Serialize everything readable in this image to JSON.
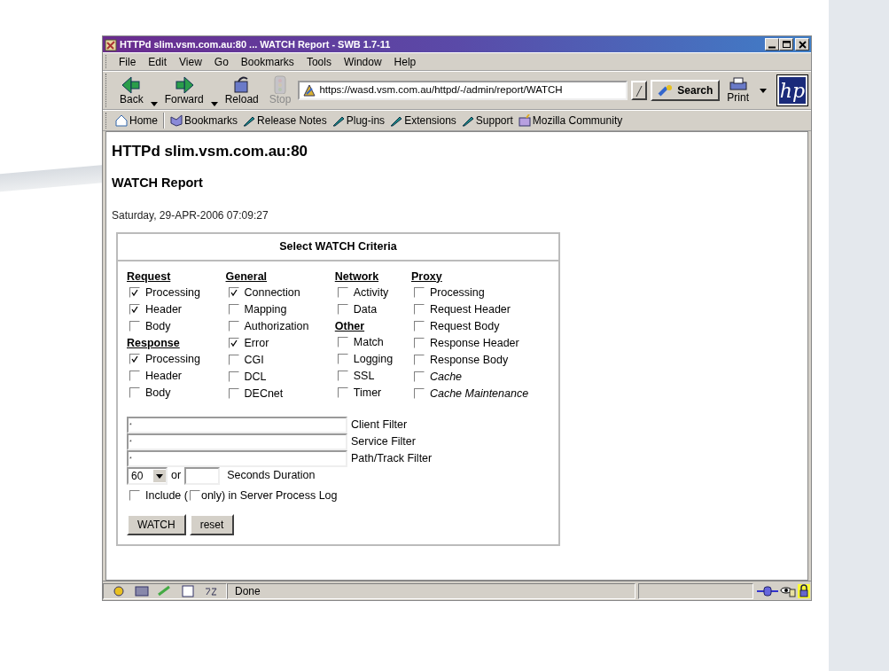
{
  "window": {
    "title": "HTTPd slim.vsm.com.au:80 ... WATCH Report - SWB 1.7-11"
  },
  "menu": [
    "File",
    "Edit",
    "View",
    "Go",
    "Bookmarks",
    "Tools",
    "Window",
    "Help"
  ],
  "toolbar": [
    {
      "kind": "back",
      "label": "Back",
      "disabled": false
    },
    {
      "kind": "forward",
      "label": "Forward",
      "disabled": false
    },
    {
      "kind": "reload",
      "label": "Reload",
      "disabled": false
    },
    {
      "kind": "stop",
      "label": "Stop",
      "disabled": true
    }
  ],
  "url": "https://wasd.vsm.com.au/httpd/-/admin/report/WATCH",
  "search_button": "Search",
  "print_button": "Print",
  "logo": "hp",
  "personal_bar": [
    {
      "kind": "home",
      "label": "Home"
    },
    {
      "kind": "bookmarks",
      "label": "Bookmarks"
    },
    {
      "kind": "link",
      "label": "Release Notes"
    },
    {
      "kind": "link",
      "label": "Plug-ins"
    },
    {
      "kind": "link",
      "label": "Extensions"
    },
    {
      "kind": "link",
      "label": "Support"
    },
    {
      "kind": "folder",
      "label": "Mozilla Community"
    }
  ],
  "page": {
    "heading": "HTTPd slim.vsm.com.au:80",
    "subheading": "WATCH Report",
    "date": "Saturday, 29-APR-2006 07:09:27",
    "criteria": {
      "title": "Select WATCH Criteria",
      "columns": [
        [
          {
            "heading": "Request",
            "items": [
              {
                "label": "Processing",
                "checked": true
              },
              {
                "label": "Header",
                "checked": true
              },
              {
                "label": "Body",
                "checked": false
              }
            ]
          },
          {
            "heading": "Response",
            "items": [
              {
                "label": "Processing",
                "checked": true
              },
              {
                "label": "Header",
                "checked": false
              },
              {
                "label": "Body",
                "checked": false
              }
            ]
          }
        ],
        [
          {
            "heading": "General",
            "items": [
              {
                "label": "Connection",
                "checked": true
              },
              {
                "label": "Mapping",
                "checked": false
              },
              {
                "label": "Authorization",
                "checked": false
              },
              {
                "label": "Error",
                "checked": true
              },
              {
                "label": "CGI",
                "checked": false
              },
              {
                "label": "DCL",
                "checked": false
              },
              {
                "label": "DECnet",
                "checked": false
              }
            ]
          }
        ],
        [
          {
            "heading": "Network",
            "items": [
              {
                "label": "Activity",
                "checked": false
              },
              {
                "label": "Data",
                "checked": false
              }
            ]
          },
          {
            "heading": "Other",
            "items": [
              {
                "label": "Match",
                "checked": false
              },
              {
                "label": "Logging",
                "checked": false
              },
              {
                "label": "SSL",
                "checked": false
              },
              {
                "label": "Timer",
                "checked": false
              }
            ]
          }
        ],
        [
          {
            "heading": "Proxy",
            "items": [
              {
                "label": "Processing",
                "checked": false,
                "italic": false
              },
              {
                "label": "Request Header",
                "checked": false,
                "italic": false
              },
              {
                "label": "Request Body",
                "checked": false,
                "italic": false
              },
              {
                "label": "Response Header",
                "checked": false,
                "italic": false
              },
              {
                "label": "Response Body",
                "checked": false,
                "italic": false
              },
              {
                "label": "Cache",
                "checked": false,
                "italic": true
              },
              {
                "label": "Cache Maintenance",
                "checked": false,
                "italic": true
              }
            ]
          }
        ]
      ],
      "filters": [
        {
          "value": "*",
          "label": "Client Filter"
        },
        {
          "value": "*",
          "label": "Service Filter"
        },
        {
          "value": "*",
          "label": "Path/Track Filter"
        }
      ],
      "duration": {
        "select": "60",
        "or": "or",
        "label": "Seconds Duration"
      },
      "include": {
        "checked": false,
        "text_before": "Include (",
        "only_checked": false,
        "text_after": "only) in Server Process Log"
      },
      "buttons": [
        "WATCH",
        "reset"
      ]
    }
  },
  "status_bar": {
    "text": "Done"
  }
}
